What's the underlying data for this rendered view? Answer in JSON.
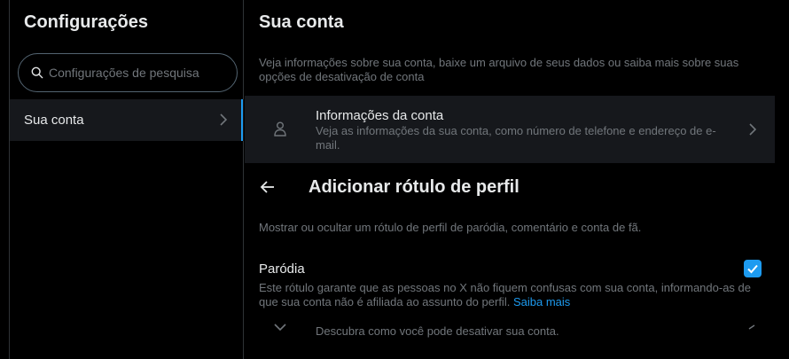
{
  "sidebar": {
    "title": "Configurações",
    "search_placeholder": "Configurações de pesquisa",
    "items": [
      {
        "label": "Sua conta",
        "active": true,
        "icon": "chevron-right-icon"
      }
    ]
  },
  "main": {
    "title": "Sua conta",
    "description": "Veja informações sobre sua conta, baixe um arquivo de seus dados ou saiba mais sobre suas opções de desativação de conta",
    "rows": [
      {
        "icon": "person-icon",
        "title": "Informações da conta",
        "subtitle": "Veja as informações da sua conta, como número de telefone e endereço de e-mail."
      }
    ],
    "peek_text": "Descubra como você pode desativar sua conta."
  },
  "dialog": {
    "title": "Adicionar rótulo de perfil",
    "description": "Mostrar ou ocultar um rótulo de perfil de paródia, comentário e conta de fã.",
    "option": {
      "label": "Paródia",
      "checked": true,
      "description": "Este rótulo garante que as pessoas no X não fiquem confusas com sua conta, informando-as de que sua conta não é afiliada ao assunto do perfil.",
      "link": "Saiba mais"
    }
  },
  "colors": {
    "accent": "#1d9bf0",
    "background": "#000000",
    "row_bg": "#16181c",
    "muted_text": "#71767b"
  }
}
